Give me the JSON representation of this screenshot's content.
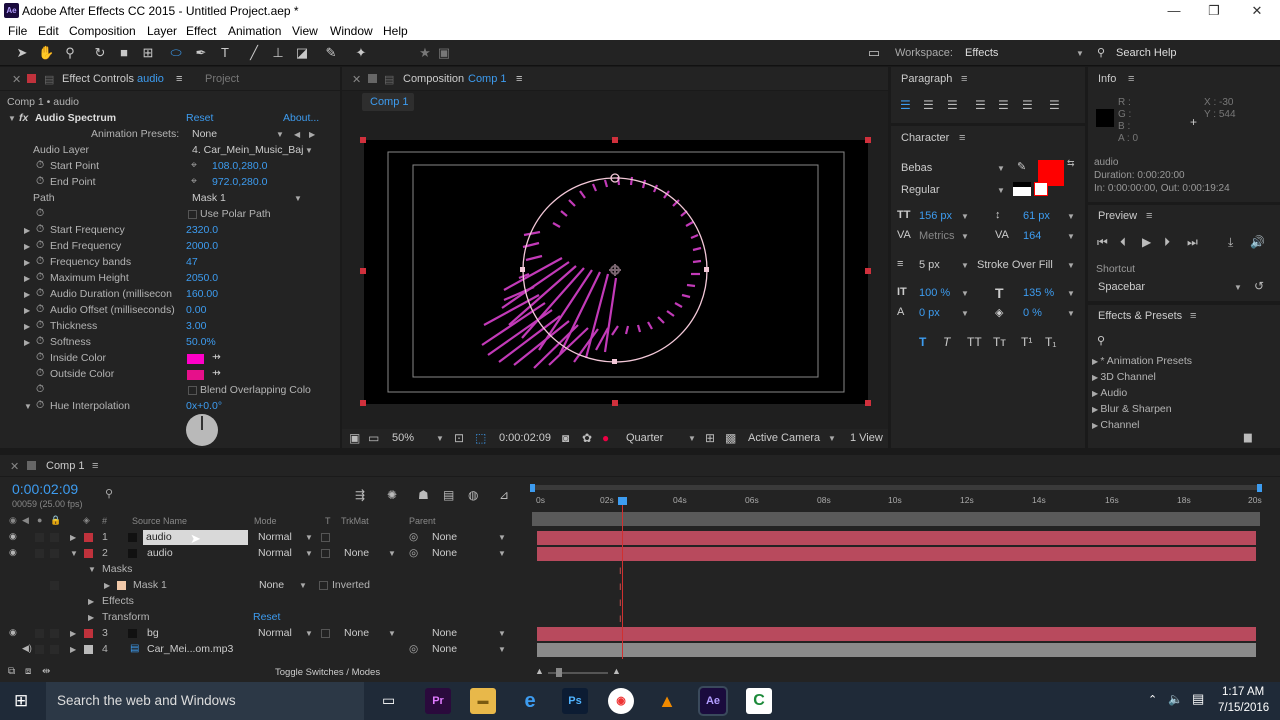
{
  "window": {
    "title": "Adobe After Effects CC 2015 - Untitled Project.aep *",
    "app_badge": "Ae",
    "min": "—",
    "max": "❐",
    "close": "✕"
  },
  "menu": [
    "File",
    "Edit",
    "Composition",
    "Layer",
    "Effect",
    "Animation",
    "View",
    "Window",
    "Help"
  ],
  "toolbar": {
    "workspace_label": "Workspace:",
    "workspace_value": "Effects",
    "search_help": "Search Help"
  },
  "effect_controls": {
    "tab_label": "Effect Controls",
    "tab_target": "audio",
    "project_tab": "Project",
    "breadcrumb": "Comp 1 • audio",
    "effect_name": "Audio Spectrum",
    "reset": "Reset",
    "about": "About...",
    "anim_presets_label": "Animation Presets:",
    "anim_presets_value": "None",
    "props": [
      {
        "label": "Audio Layer",
        "value": "4. Car_Mein_Music_Baj"
      },
      {
        "label": "Start Point",
        "value": "108.0,280.0"
      },
      {
        "label": "End Point",
        "value": "972.0,280.0"
      },
      {
        "label": "Path",
        "value": "Mask 1"
      },
      {
        "label": "",
        "value": "Use Polar Path"
      },
      {
        "label": "Start Frequency",
        "value": "2320.0"
      },
      {
        "label": "End Frequency",
        "value": "2000.0"
      },
      {
        "label": "Frequency bands",
        "value": "47"
      },
      {
        "label": "Maximum Height",
        "value": "2050.0"
      },
      {
        "label": "Audio Duration (millisecon",
        "value": "160.00"
      },
      {
        "label": "Audio Offset (milliseconds)",
        "value": "0.00"
      },
      {
        "label": "Thickness",
        "value": "3.00"
      },
      {
        "label": "Softness",
        "value": "50.0%"
      },
      {
        "label": "Inside Color",
        "value": ""
      },
      {
        "label": "Outside Color",
        "value": ""
      },
      {
        "label": "",
        "value": "Blend Overlapping Colo"
      },
      {
        "label": "Hue Interpolation",
        "value": "0x+0.0°"
      }
    ]
  },
  "composition": {
    "tab_prefix": "Composition",
    "tab_name": "Comp 1",
    "sub_tab": "Comp 1",
    "zoom": "50%",
    "timecode": "0:00:02:09",
    "resolution": "Quarter",
    "camera": "Active Camera",
    "views": "1 View"
  },
  "paragraph": {
    "title": "Paragraph"
  },
  "character": {
    "title": "Character",
    "font": "Bebas",
    "style": "Regular",
    "size": "156 px",
    "leading": "61 px",
    "kerning": "Metrics",
    "tracking": "164",
    "stroke_width": "5 px",
    "stroke_type": "Stroke Over Fill",
    "vscale": "100 %",
    "hscale": "135 %",
    "baseline": "0 px",
    "tsume": "0 %",
    "fill_color": "#ff0000"
  },
  "info": {
    "title": "Info",
    "r": "R :",
    "g": "G :",
    "b": "B :",
    "a": "A : 0",
    "x": "X : -30",
    "y": "Y : 544",
    "layer": "audio",
    "duration": "Duration: 0:00:20:00",
    "inout": "In: 0:00:00:00, Out: 0:00:19:24"
  },
  "preview": {
    "title": "Preview",
    "shortcut_label": "Shortcut",
    "shortcut_value": "Spacebar"
  },
  "effects_presets": {
    "title": "Effects & Presets",
    "items": [
      "* Animation Presets",
      "3D Channel",
      "Audio",
      "Blur & Sharpen",
      "Channel"
    ]
  },
  "timeline": {
    "tab": "Comp 1",
    "timecode": "0:00:02:09",
    "fps": "00059 (25.00 fps)",
    "headers": {
      "num": "#",
      "source": "Source Name",
      "mode": "Mode",
      "t": "T",
      "trkmat": "TrkMat",
      "parent": "Parent"
    },
    "ruler": [
      "0s",
      "02s",
      "04s",
      "06s",
      "08s",
      "10s",
      "12s",
      "14s",
      "16s",
      "18s",
      "20s"
    ],
    "layers": [
      {
        "num": "1",
        "name": "audio",
        "mode": "Normal",
        "trkmat": "",
        "parent": "None"
      },
      {
        "num": "2",
        "name": "audio",
        "mode": "Normal",
        "trkmat": "None",
        "parent": "None"
      },
      {
        "num": "3",
        "name": "bg",
        "mode": "Normal",
        "trkmat": "None",
        "parent": "None"
      },
      {
        "num": "4",
        "name": "Car_Mei...om.mp3",
        "mode": "",
        "trkmat": "",
        "parent": "None"
      }
    ],
    "sub": {
      "masks": "Masks",
      "mask1": "Mask 1",
      "mask_mode": "None",
      "inverted": "Inverted",
      "effects": "Effects",
      "transform": "Transform",
      "reset": "Reset"
    },
    "toggle": "Toggle Switches / Modes"
  },
  "taskbar": {
    "search": "Search the web and Windows",
    "time": "1:17 AM",
    "date": "7/15/2016"
  }
}
